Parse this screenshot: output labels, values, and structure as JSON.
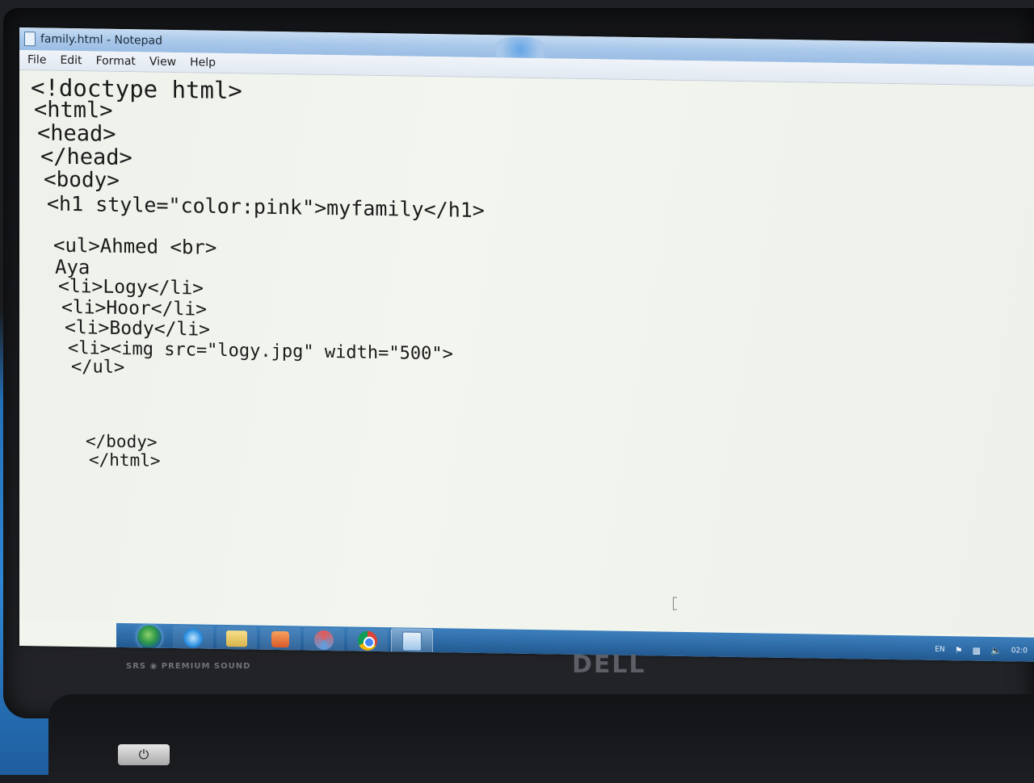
{
  "window": {
    "title": "family.html - Notepad"
  },
  "menu": [
    {
      "id": "file",
      "label": "File"
    },
    {
      "id": "edit",
      "label": "Edit"
    },
    {
      "id": "format",
      "label": "Format"
    },
    {
      "id": "view",
      "label": "View"
    },
    {
      "id": "help",
      "label": "Help"
    }
  ],
  "editor": {
    "lines": [
      "<!doctype html>",
      "<html>",
      "<head>",
      "</head>",
      "<body>",
      "<h1 style=\"color:pink\">myfamily</h1>",
      "",
      "<ul>Ahmed <br>",
      "Aya",
      "<li>Logy</li>",
      "<li>Hoor</li>",
      "<li>Body</li>",
      "<li><img src=\"logy.jpg\" width=\"500\">",
      "</ul>",
      "",
      "",
      "",
      "</body>",
      "</html>"
    ]
  },
  "taskbar": {
    "icons": [
      "start-orb-icon",
      "internet-explorer-icon",
      "folder-icon",
      "media-player-icon",
      "sync-icon",
      "chrome-icon",
      "notepad-icon"
    ],
    "tray": {
      "language": "EN",
      "clock": "02:0"
    }
  },
  "hardware": {
    "speaker_label": "SRS ◉ PREMIUM SOUND",
    "brand": "DELL",
    "power_glyph": "⏻"
  }
}
